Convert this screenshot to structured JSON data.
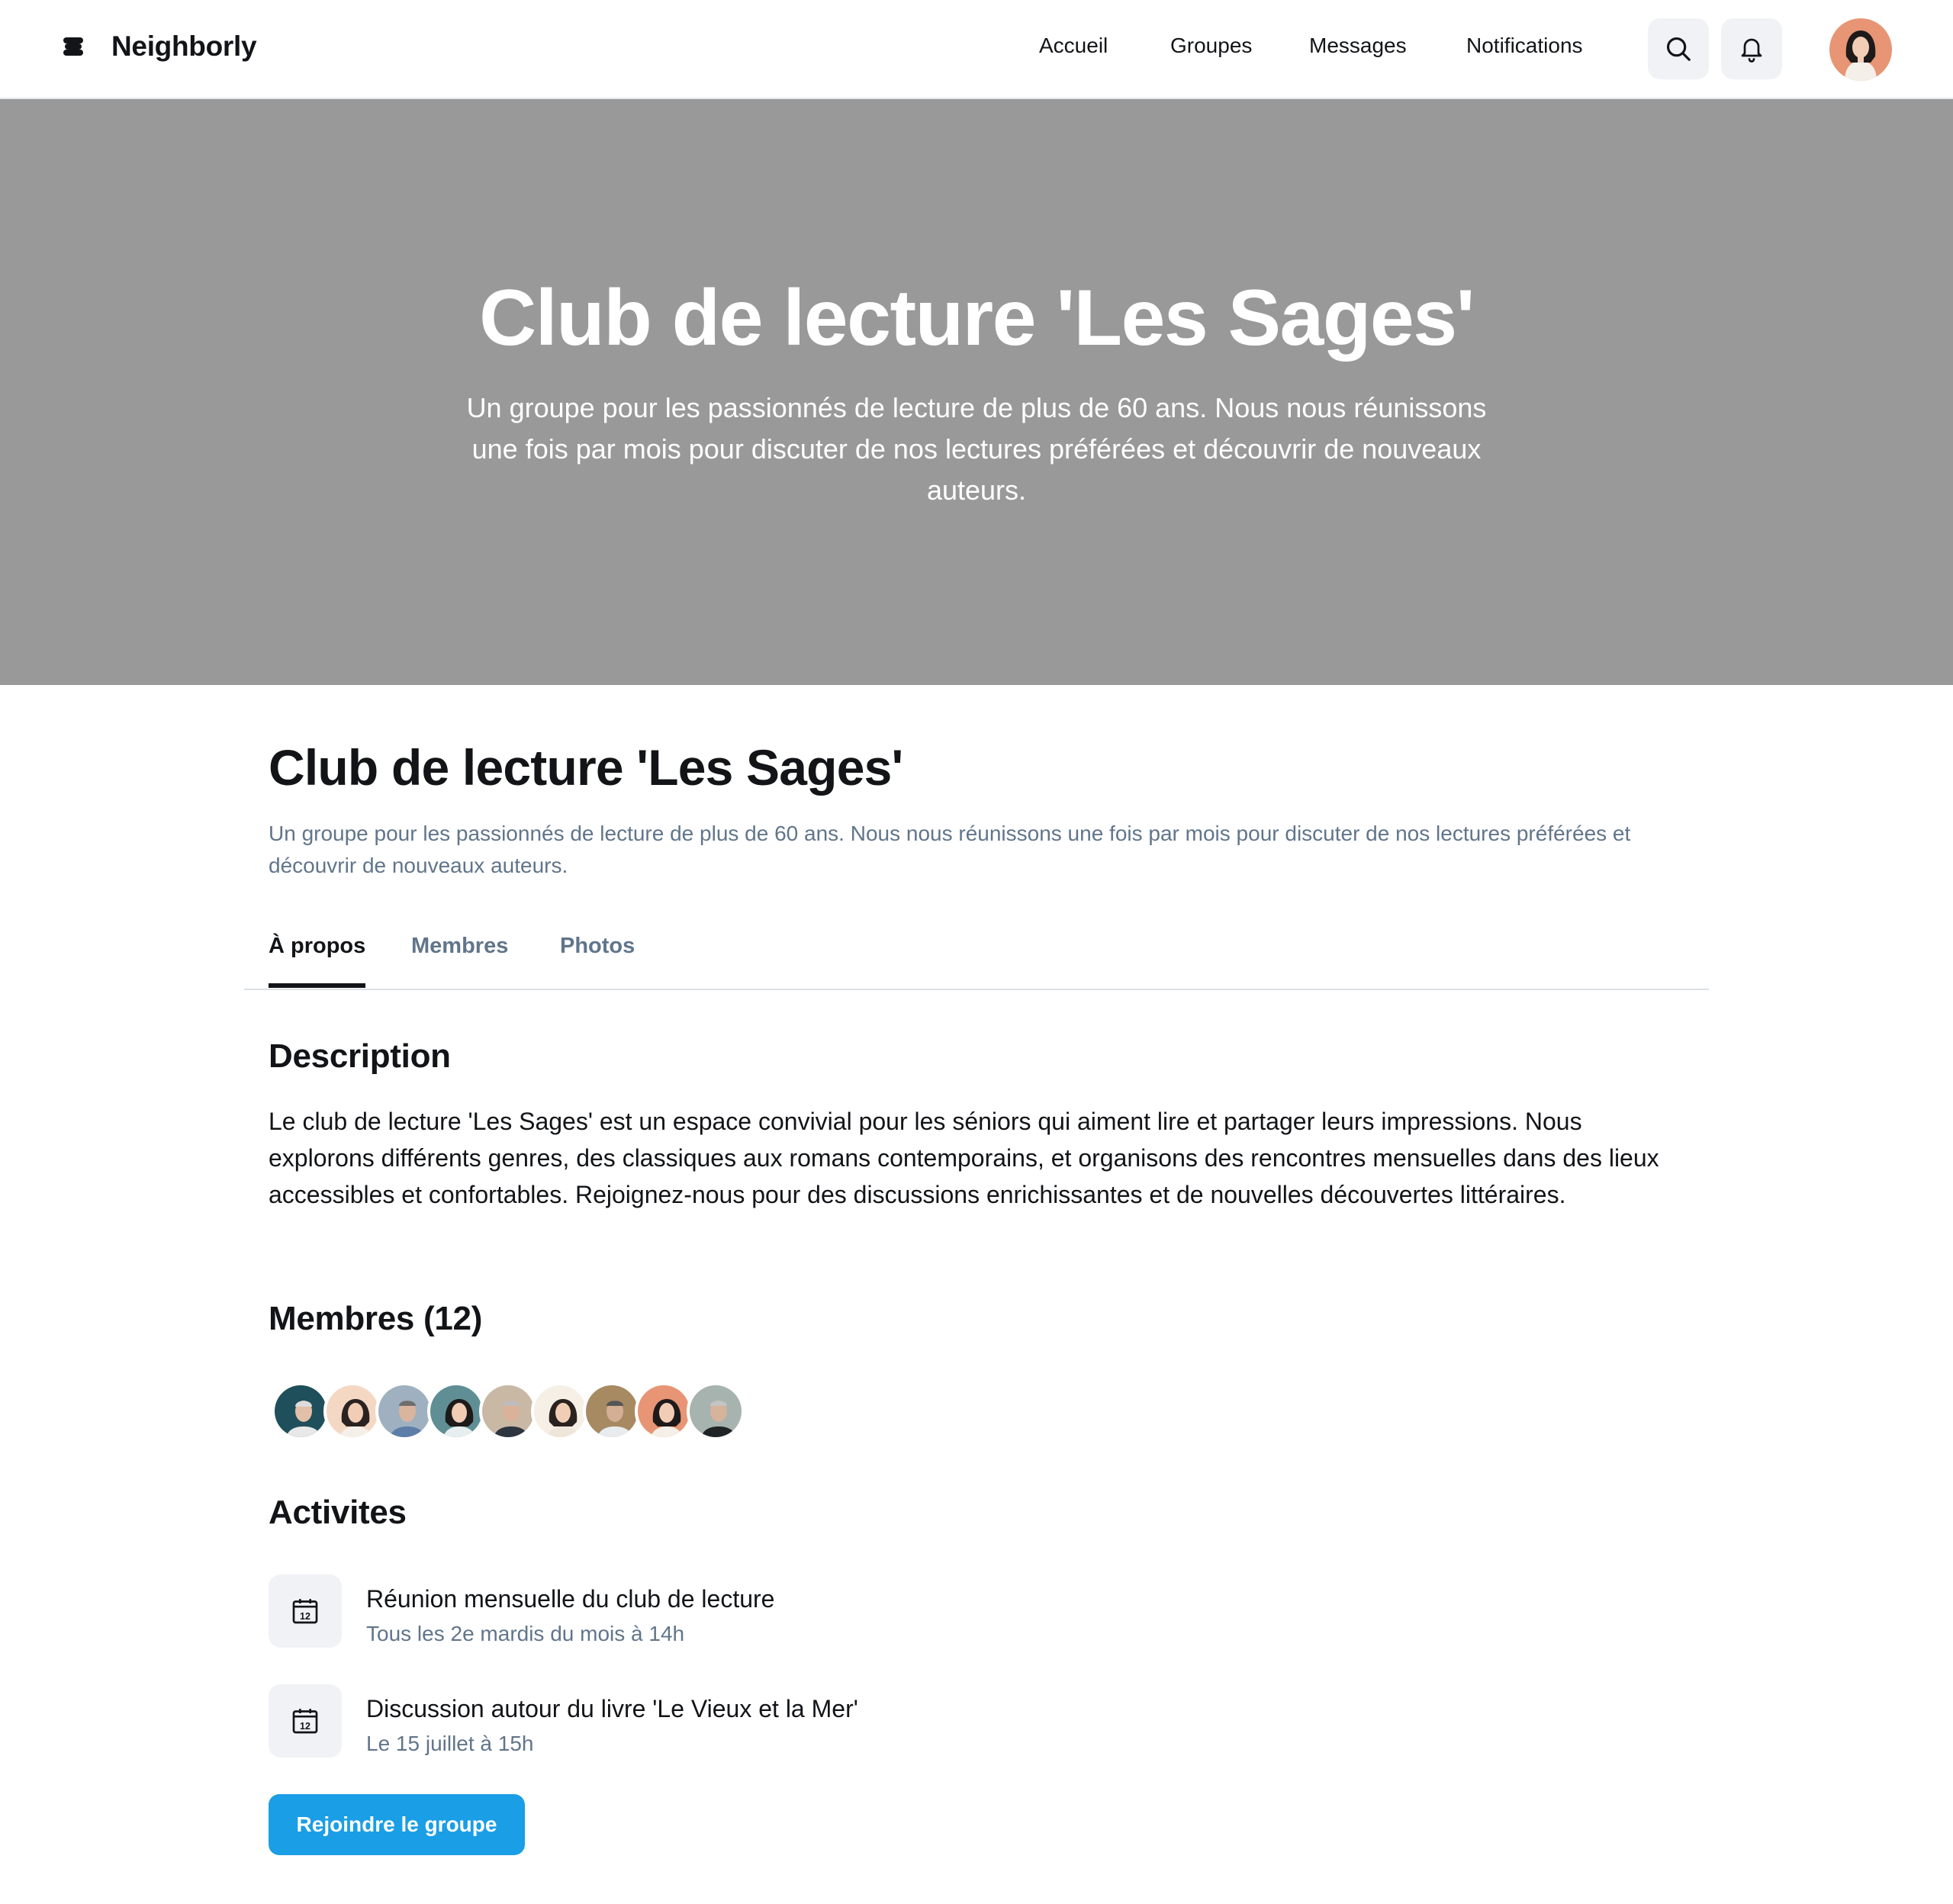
{
  "app": {
    "name": "Neighborly"
  },
  "nav": {
    "links": [
      "Accueil",
      "Groupes",
      "Messages",
      "Notifications"
    ]
  },
  "hero": {
    "title": "Club de lecture 'Les Sages'",
    "subtitle": "Un groupe pour les passionnés de lecture de plus de 60 ans. Nous nous réunissons une fois par mois pour discuter de nos lectures préférées et découvrir de nouveaux auteurs."
  },
  "group": {
    "title": "Club de lecture 'Les Sages'",
    "subtitle": "Un groupe pour les passionnés de lecture de plus de 60 ans. Nous nous réunissons une fois par mois pour discuter de nos lectures préférées et découvrir de nouveaux auteurs."
  },
  "tabs": [
    "À propos",
    "Membres",
    "Photos"
  ],
  "description": {
    "heading": "Description",
    "text": "Le club de lecture 'Les Sages' est un espace convivial pour les séniors qui aiment lire et partager leurs impressions. Nous explorons différents genres, des classiques aux romans contemporains, et organisons des rencontres mensuelles dans des lieux accessibles et confortables. Rejoignez-nous pour des discussions enrichissantes et de nouvelles découvertes littéraires."
  },
  "members": {
    "heading": "Membres (12)"
  },
  "activities": {
    "heading": "Activites",
    "items": [
      {
        "title": "Réunion mensuelle du club de lecture",
        "time": "Tous les 2e mardis du mois à 14h",
        "icon": "calendar-icon",
        "icon_text": "12"
      },
      {
        "title": "Discussion autour du livre 'Le Vieux et la Mer'",
        "time": "Le 15 juillet à 15h",
        "icon": "calendar-icon",
        "icon_text": "12"
      }
    ]
  },
  "join_button": "Rejoindre le groupe",
  "colors": {
    "accent": "#1a9ee5",
    "hero_bg": "#999999",
    "muted_text": "#61758a",
    "icon_bg": "#f0f2f5"
  }
}
